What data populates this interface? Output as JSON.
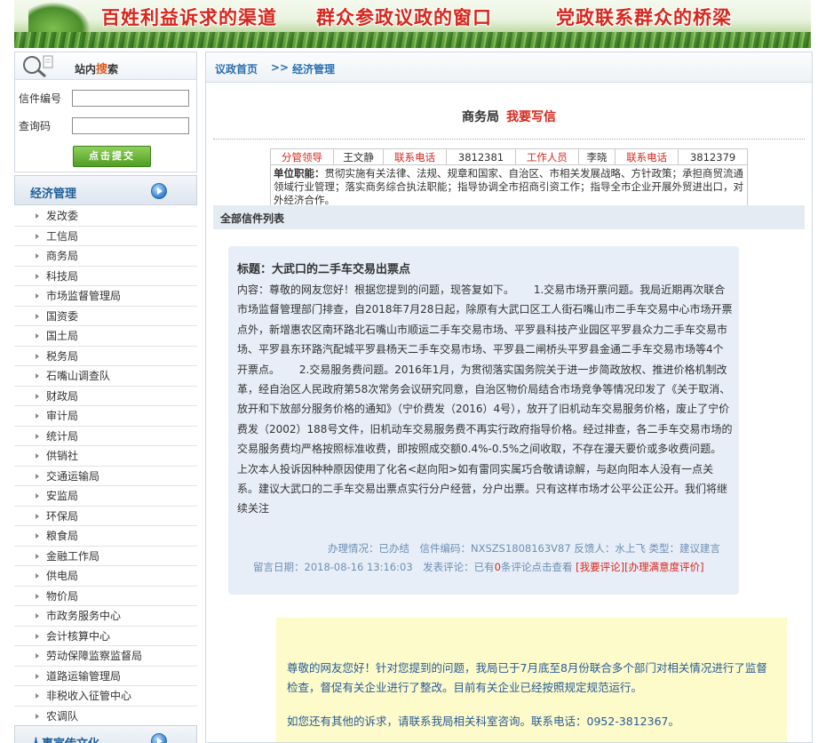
{
  "banner": {
    "slogan1": "百姓利益诉求的渠道",
    "slogan2": "群众参政议政的窗口",
    "slogan3": "党政联系群众的桥梁"
  },
  "search": {
    "title_prefix": "站内",
    "title_highlight": "搜",
    "title_suffix": "索",
    "letter_no_label": "信件编号",
    "query_code_label": "查询码",
    "letter_no_value": "",
    "query_code_value": "",
    "submit_label": "点击提交"
  },
  "sidebar": {
    "category_title": "经济管理",
    "items": [
      "发改委",
      "工信局",
      "商务局",
      "科技局",
      "市场监督管理局",
      "国资委",
      "国土局",
      "税务局",
      "石嘴山调查队",
      "财政局",
      "审计局",
      "统计局",
      "供销社",
      "交通运输局",
      "安监局",
      "环保局",
      "粮食局",
      "金融工作局",
      "供电局",
      "物价局",
      "市政务服务中心",
      "会计核算中心",
      "劳动保障监察监督局",
      "道路运输管理局",
      "非税收入征管中心",
      "农调队"
    ],
    "next_category_title": "人事宣传文化"
  },
  "breadcrumb": {
    "home": "议政首页",
    "separator": ">>",
    "current": "经济管理"
  },
  "department": {
    "name": "商务局",
    "write_link": "我要写信",
    "leader_label": "分管领导",
    "leader_name": "王文静",
    "phone_label1": "联系电话",
    "phone1": "3812381",
    "staff_label": "工作人员",
    "staff_name": "李晓",
    "phone_label2": "联系电话",
    "phone2": "3812379",
    "duty_label": "单位职能：",
    "duty_text": "贯彻实施有关法律、法规、规章和国家、自治区、市相关发展战略、方针政策；承担商贸流通领域行业管理；落实商务综合执法职能；指导协调全市招商引资工作；指导全市企业开展外贸进出口，对外经济合作。"
  },
  "list": {
    "header": "全部信件列表"
  },
  "letter": {
    "title": "标题：大武口的二手车交易出票点",
    "content": "内容：尊敬的网友您好！根据您提到的问题，现答复如下。　　 1.交易市场开票问题。我局近期再次联合市场监督管理部门排查，自2018年7月28日起，除原有大武口区工人街石嘴山市二手车交易中心市场开票点外，新增惠农区南环路北石嘴山市顺运二手车交易市场、平罗县科技产业园区平罗县众力二手车交易市场、平罗县东环路汽配城平罗县杨天二手车交易市场、平罗县二闸桥头平罗县金通二手车交易市场等4个开票点。　　 2.交易服务费问题。2016年1月，为贯彻落实国务院关于进一步简政放权、推进价格机制改革，经自治区人民政府第58次常务会议研究同意，自治区物价局结合市场竞争等情况印发了《关于取消、放开和下放部分服务价格的通知》（宁价费发（2016）4号），放开了旧机动车交易服务价格，废止了宁价费发（2002）188号文件，旧机动车交易服务费不再实行政府指导价格。经过排查，各二手车交易市场的交易服务费均严格按照标准收费，即按照成交额0.4%-0.5%之间收取，不存在漫天要价或多收费问题。 上次本人投诉因种种原因使用了化名<赵向阳>如有雷同实属巧合敬请谅解，与赵向阳本人没有一点关系。建议大武口的二手车交易出票点实行分户经营，分户出票。只有这样市场才公平公正公开。我们将继续关注",
    "meta_line1": "办理情况：已办结　信件编码：NXSZS1808163V87 反馈人：水上飞 类型：建议建言",
    "date_label": "留言日期：2018-08-16 13:16:03　发表评论：已有",
    "comment_count": "0",
    "comment_suffix": "条评论点击查看",
    "action_links": "[我要评论][办理满意度评价]"
  },
  "reply": {
    "para1": "尊敬的网友您好！针对您提到的问题，我局已于7月底至8月份联合多个部门对相关情况进行了监督检查，督促有关企业进行了整改。目前有关企业已经按照规定规范运行。",
    "para2": "如您还有其他的诉求，请联系我局相关科室咨询。联系电话：0952-3812367。"
  }
}
